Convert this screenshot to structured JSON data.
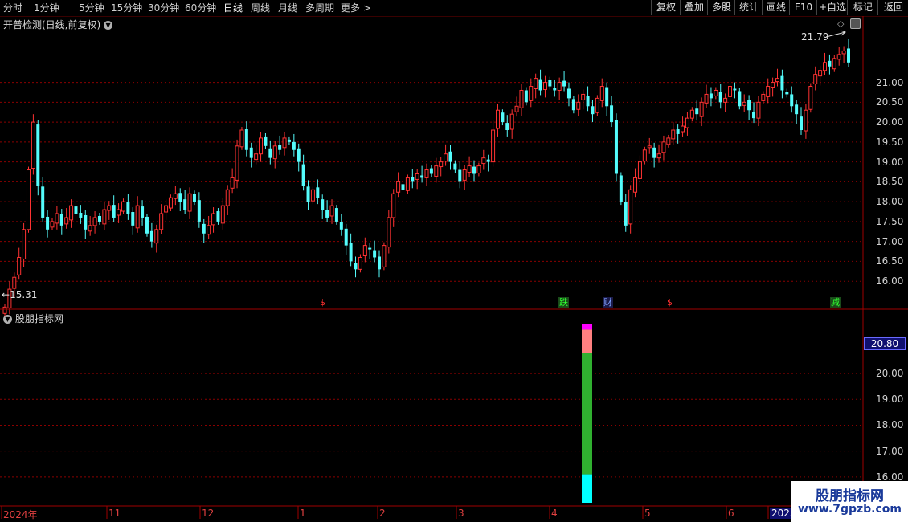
{
  "toolbar": {
    "periods": [
      "分时",
      "1分钟",
      "5分钟",
      "15分钟",
      "30分钟",
      "60分钟",
      "日线",
      "周线",
      "月线",
      "多周期",
      "更多 >"
    ],
    "active_period": "日线",
    "buttons": [
      "复权",
      "叠加",
      "多股",
      "统计",
      "画线",
      "F10",
      "+自选",
      "返回"
    ]
  },
  "main_panel": {
    "title": "开普检测(日线,前复权)",
    "high_label": "21.79",
    "low_label": "15.31",
    "y_ticks": [
      "21.00",
      "20.50",
      "20.00",
      "19.50",
      "19.00",
      "18.50",
      "18.00",
      "17.50",
      "17.00",
      "16.50",
      "16.00"
    ],
    "signals": [
      {
        "text": "$",
        "color": "#ff3030"
      },
      {
        "text": "跌",
        "color": "#30ff30"
      },
      {
        "text": "财",
        "color": "#4080ff"
      },
      {
        "text": "$",
        "color": "#ff3030"
      },
      {
        "text": "减",
        "color": "#30ff30"
      }
    ]
  },
  "sub_panel": {
    "title": "股朋指标网",
    "highlight_value": "20.80",
    "y_ticks": [
      "20.00",
      "19.00",
      "18.00",
      "17.00",
      "16.00"
    ]
  },
  "x_axis": {
    "labels": [
      "2024年",
      "11",
      "12",
      "1",
      "2",
      "3",
      "4",
      "5",
      "6",
      "2025"
    ]
  },
  "watermark": {
    "title": "股朋指标网",
    "url": "www.7gpzb.com"
  },
  "colors": {
    "up": "#ff3232",
    "down": "#54fcfc",
    "grid": "#8a0000",
    "frame": "#a00000"
  },
  "chart_data": {
    "type": "candlestick",
    "title": "开普检测(日线,前复权)",
    "y_range": [
      15.6,
      21.9
    ],
    "x_labels": [
      "2024年",
      "11",
      "12",
      "1",
      "2",
      "3",
      "4",
      "5",
      "6",
      "2025"
    ],
    "closes": [
      15.35,
      15.8,
      16.1,
      16.6,
      17.3,
      18.8,
      20.0,
      18.4,
      17.6,
      17.3,
      17.5,
      17.7,
      17.4,
      17.6,
      17.9,
      17.7,
      17.6,
      17.3,
      17.4,
      17.6,
      17.5,
      17.8,
      17.9,
      17.6,
      17.8,
      18.0,
      17.7,
      17.4,
      17.9,
      17.6,
      17.2,
      17.0,
      17.3,
      17.7,
      17.9,
      18.1,
      18.2,
      18.0,
      17.8,
      18.2,
      18.0,
      17.5,
      17.2,
      17.4,
      17.7,
      17.5,
      17.9,
      18.3,
      18.6,
      19.4,
      19.8,
      19.3,
      19.1,
      19.2,
      19.6,
      19.4,
      19.1,
      19.4,
      19.3,
      19.6,
      19.5,
      19.3,
      19.0,
      18.4,
      18.0,
      18.3,
      18.1,
      17.8,
      17.6,
      17.9,
      17.5,
      17.3,
      16.9,
      16.5,
      16.3,
      16.6,
      16.9,
      16.8,
      16.6,
      16.3,
      16.9,
      17.6,
      18.2,
      18.5,
      18.3,
      18.6,
      18.5,
      18.7,
      18.6,
      18.8,
      18.7,
      18.9,
      19.0,
      19.2,
      19.0,
      18.8,
      18.5,
      18.8,
      18.9,
      18.7,
      18.9,
      19.1,
      19.0,
      19.8,
      20.3,
      20.0,
      19.8,
      20.2,
      20.4,
      20.8,
      20.5,
      20.9,
      21.1,
      20.8,
      21.0,
      20.9,
      20.8,
      21.0,
      20.9,
      20.6,
      20.3,
      20.5,
      20.7,
      20.4,
      20.2,
      20.6,
      20.9,
      20.4,
      20.0,
      18.7,
      18.0,
      17.4,
      18.3,
      18.6,
      19.0,
      19.3,
      19.4,
      19.1,
      19.2,
      19.5,
      19.6,
      19.8,
      19.7,
      19.9,
      20.1,
      20.3,
      20.2,
      20.5,
      20.7,
      20.6,
      20.8,
      20.5,
      20.6,
      20.9,
      20.8,
      20.4,
      20.5,
      20.3,
      20.1,
      20.5,
      20.7,
      20.9,
      21.0,
      21.1,
      20.8,
      20.7,
      20.4,
      20.2,
      19.8,
      20.3,
      20.9,
      21.2,
      21.3,
      21.5,
      21.4,
      21.6,
      21.7,
      21.79,
      21.5
    ],
    "sub_bar_segments": [
      {
        "color": "#ff00ff",
        "from": 21.9,
        "to": 21.7
      },
      {
        "color": "#ff8080",
        "from": 21.7,
        "to": 20.8
      },
      {
        "color": "#30b030",
        "from": 20.8,
        "to": 16.1
      },
      {
        "color": "#00ffff",
        "from": 16.1,
        "to": 15.0
      }
    ],
    "sub_y_range": [
      15.0,
      21.9
    ]
  }
}
